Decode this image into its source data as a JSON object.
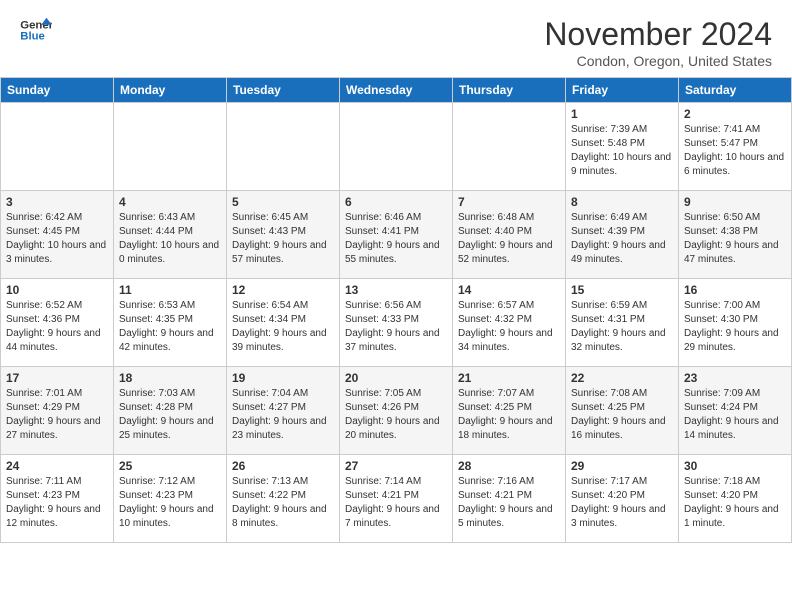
{
  "header": {
    "logo_line1": "General",
    "logo_line2": "Blue",
    "month_title": "November 2024",
    "location": "Condon, Oregon, United States"
  },
  "weekdays": [
    "Sunday",
    "Monday",
    "Tuesday",
    "Wednesday",
    "Thursday",
    "Friday",
    "Saturday"
  ],
  "weeks": [
    [
      {
        "day": "",
        "info": ""
      },
      {
        "day": "",
        "info": ""
      },
      {
        "day": "",
        "info": ""
      },
      {
        "day": "",
        "info": ""
      },
      {
        "day": "",
        "info": ""
      },
      {
        "day": "1",
        "info": "Sunrise: 7:39 AM\nSunset: 5:48 PM\nDaylight: 10 hours and 9 minutes."
      },
      {
        "day": "2",
        "info": "Sunrise: 7:41 AM\nSunset: 5:47 PM\nDaylight: 10 hours and 6 minutes."
      }
    ],
    [
      {
        "day": "3",
        "info": "Sunrise: 6:42 AM\nSunset: 4:45 PM\nDaylight: 10 hours and 3 minutes."
      },
      {
        "day": "4",
        "info": "Sunrise: 6:43 AM\nSunset: 4:44 PM\nDaylight: 10 hours and 0 minutes."
      },
      {
        "day": "5",
        "info": "Sunrise: 6:45 AM\nSunset: 4:43 PM\nDaylight: 9 hours and 57 minutes."
      },
      {
        "day": "6",
        "info": "Sunrise: 6:46 AM\nSunset: 4:41 PM\nDaylight: 9 hours and 55 minutes."
      },
      {
        "day": "7",
        "info": "Sunrise: 6:48 AM\nSunset: 4:40 PM\nDaylight: 9 hours and 52 minutes."
      },
      {
        "day": "8",
        "info": "Sunrise: 6:49 AM\nSunset: 4:39 PM\nDaylight: 9 hours and 49 minutes."
      },
      {
        "day": "9",
        "info": "Sunrise: 6:50 AM\nSunset: 4:38 PM\nDaylight: 9 hours and 47 minutes."
      }
    ],
    [
      {
        "day": "10",
        "info": "Sunrise: 6:52 AM\nSunset: 4:36 PM\nDaylight: 9 hours and 44 minutes."
      },
      {
        "day": "11",
        "info": "Sunrise: 6:53 AM\nSunset: 4:35 PM\nDaylight: 9 hours and 42 minutes."
      },
      {
        "day": "12",
        "info": "Sunrise: 6:54 AM\nSunset: 4:34 PM\nDaylight: 9 hours and 39 minutes."
      },
      {
        "day": "13",
        "info": "Sunrise: 6:56 AM\nSunset: 4:33 PM\nDaylight: 9 hours and 37 minutes."
      },
      {
        "day": "14",
        "info": "Sunrise: 6:57 AM\nSunset: 4:32 PM\nDaylight: 9 hours and 34 minutes."
      },
      {
        "day": "15",
        "info": "Sunrise: 6:59 AM\nSunset: 4:31 PM\nDaylight: 9 hours and 32 minutes."
      },
      {
        "day": "16",
        "info": "Sunrise: 7:00 AM\nSunset: 4:30 PM\nDaylight: 9 hours and 29 minutes."
      }
    ],
    [
      {
        "day": "17",
        "info": "Sunrise: 7:01 AM\nSunset: 4:29 PM\nDaylight: 9 hours and 27 minutes."
      },
      {
        "day": "18",
        "info": "Sunrise: 7:03 AM\nSunset: 4:28 PM\nDaylight: 9 hours and 25 minutes."
      },
      {
        "day": "19",
        "info": "Sunrise: 7:04 AM\nSunset: 4:27 PM\nDaylight: 9 hours and 23 minutes."
      },
      {
        "day": "20",
        "info": "Sunrise: 7:05 AM\nSunset: 4:26 PM\nDaylight: 9 hours and 20 minutes."
      },
      {
        "day": "21",
        "info": "Sunrise: 7:07 AM\nSunset: 4:25 PM\nDaylight: 9 hours and 18 minutes."
      },
      {
        "day": "22",
        "info": "Sunrise: 7:08 AM\nSunset: 4:25 PM\nDaylight: 9 hours and 16 minutes."
      },
      {
        "day": "23",
        "info": "Sunrise: 7:09 AM\nSunset: 4:24 PM\nDaylight: 9 hours and 14 minutes."
      }
    ],
    [
      {
        "day": "24",
        "info": "Sunrise: 7:11 AM\nSunset: 4:23 PM\nDaylight: 9 hours and 12 minutes."
      },
      {
        "day": "25",
        "info": "Sunrise: 7:12 AM\nSunset: 4:23 PM\nDaylight: 9 hours and 10 minutes."
      },
      {
        "day": "26",
        "info": "Sunrise: 7:13 AM\nSunset: 4:22 PM\nDaylight: 9 hours and 8 minutes."
      },
      {
        "day": "27",
        "info": "Sunrise: 7:14 AM\nSunset: 4:21 PM\nDaylight: 9 hours and 7 minutes."
      },
      {
        "day": "28",
        "info": "Sunrise: 7:16 AM\nSunset: 4:21 PM\nDaylight: 9 hours and 5 minutes."
      },
      {
        "day": "29",
        "info": "Sunrise: 7:17 AM\nSunset: 4:20 PM\nDaylight: 9 hours and 3 minutes."
      },
      {
        "day": "30",
        "info": "Sunrise: 7:18 AM\nSunset: 4:20 PM\nDaylight: 9 hours and 1 minute."
      }
    ]
  ]
}
